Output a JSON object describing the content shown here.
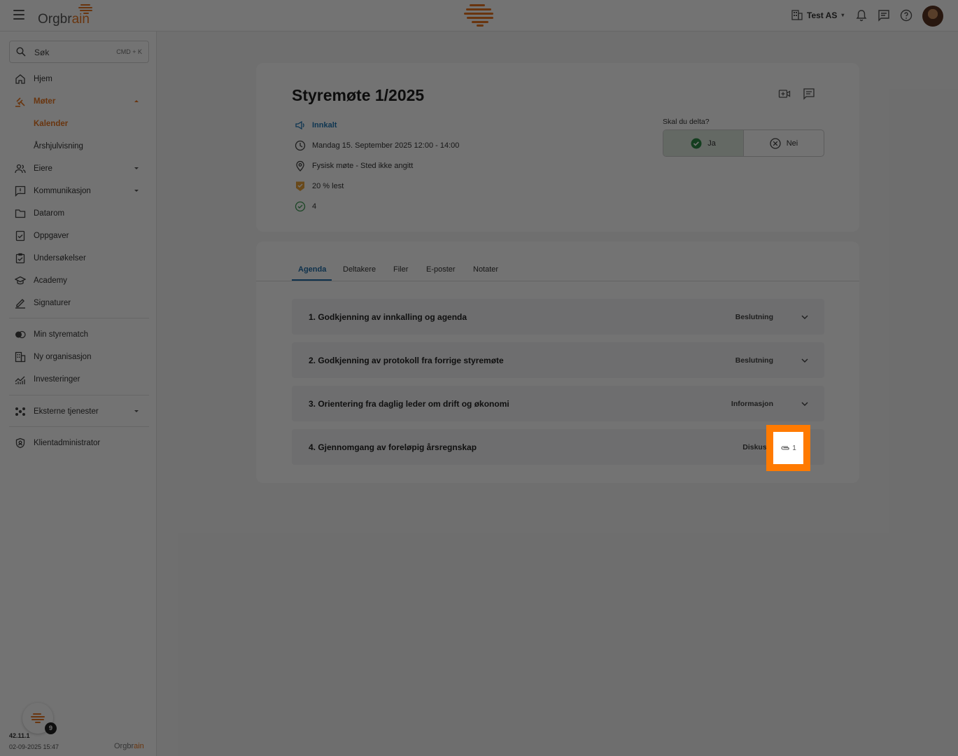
{
  "topbar": {
    "logo_prefix": "Orgbr",
    "logo_suffix": "ain",
    "org_name": "Test AS",
    "icons": [
      "menu-icon",
      "building-icon",
      "bell-icon",
      "chat-icon",
      "help-icon",
      "avatar"
    ]
  },
  "sidebar": {
    "search_label": "Søk",
    "search_shortcut": "CMD + K",
    "items": [
      {
        "label": "Hjem",
        "icon": "home-icon"
      },
      {
        "label": "Møter",
        "icon": "gavel-icon"
      },
      {
        "label": "Kalender"
      },
      {
        "label": "Årshjulvisning"
      },
      {
        "label": "Eiere",
        "icon": "owners-icon"
      },
      {
        "label": "Kommunikasjon",
        "icon": "message-icon"
      },
      {
        "label": "Datarom",
        "icon": "folder-icon"
      },
      {
        "label": "Oppgaver",
        "icon": "task-icon"
      },
      {
        "label": "Undersøkelser",
        "icon": "survey-icon"
      },
      {
        "label": "Academy",
        "icon": "academy-icon"
      },
      {
        "label": "Signaturer",
        "icon": "signature-icon"
      },
      {
        "label": "Min styrematch",
        "icon": "match-icon"
      },
      {
        "label": "Ny organisasjon",
        "icon": "building-icon"
      },
      {
        "label": "Investeringer",
        "icon": "chart-icon"
      },
      {
        "label": "Eksterne tjenester",
        "icon": "services-icon"
      },
      {
        "label": "Klientadministrator",
        "icon": "shield-icon"
      }
    ],
    "help_badge_count": "9",
    "version": "42.11.1",
    "build_date": "02-09-2025 15:47",
    "footer_logo_prefix": "Orgbr",
    "footer_logo_suffix": "ain"
  },
  "meeting": {
    "title": "Styremøte 1/2025",
    "status": "Innkalt",
    "datetime": "Mandag 15. September 2025 12:00 - 14:00",
    "location": "Fysisk møte - Sted ikke angitt",
    "read_status": "20 % lest",
    "approved_count": "4",
    "rsvp_question": "Skal du delta?",
    "rsvp_yes": "Ja",
    "rsvp_no": "Nei"
  },
  "tabs": [
    "Agenda",
    "Deltakere",
    "Filer",
    "E-poster",
    "Notater"
  ],
  "agenda": [
    {
      "title": "1. Godkjenning av innkalling og agenda",
      "type": "Beslutning"
    },
    {
      "title": "2. Godkjenning av protokoll fra forrige styremøte",
      "type": "Beslutning"
    },
    {
      "title": "3. Orientering fra daglig leder om drift og økonomi",
      "type": "Informasjon"
    },
    {
      "title": "4. Gjennomgang av foreløpig årsregnskap",
      "type": "Diskusjo",
      "attachments": "1"
    }
  ],
  "colors": {
    "accent": "#e87722",
    "link": "#1f6ea8",
    "highlight": "#ff7a00"
  }
}
